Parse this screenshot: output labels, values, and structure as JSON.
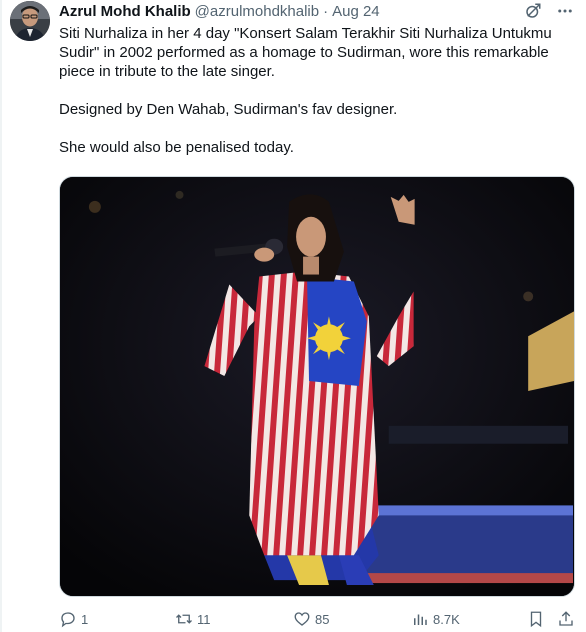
{
  "author": {
    "name": "Azrul Mohd Khalib",
    "handle": "@azrulmohdkhalib",
    "separator": "·",
    "time": "Aug 24"
  },
  "tweet": {
    "paragraphs": [
      "Siti Nurhaliza in her 4 day \"Konsert Salam Terakhir Siti Nurhaliza Untukmu Sudir\" in 2002 performed as a homage to Sudirman, wore this remarkable piece in tribute to the late singer.",
      "Designed by Den Wahab, Sudirman's fav designer.",
      "She would also be penalised today."
    ]
  },
  "media": {
    "icon": "photo-of-performer-on-stage"
  },
  "header_icons": [
    "grok-icon",
    "more-icon"
  ],
  "actions": {
    "replies": "1",
    "retweets": "11",
    "likes": "85",
    "views": "8.7K"
  },
  "colors": {
    "text": "#0f1419",
    "secondary": "#536471",
    "border": "#cfd9de"
  }
}
